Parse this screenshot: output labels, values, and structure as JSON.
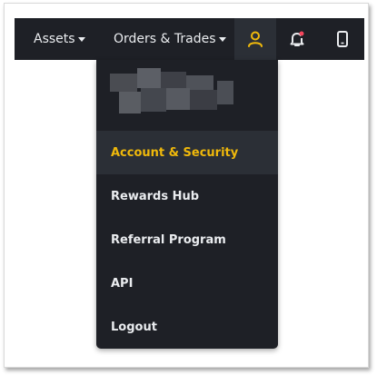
{
  "nav": {
    "assets_label": "Assets",
    "orders_label": "Orders & Trades"
  },
  "icons": {
    "user": "user-icon",
    "bell": "bell-icon",
    "phone": "mobile-icon"
  },
  "menu": {
    "items": [
      {
        "label": "Account & Security",
        "active": true
      },
      {
        "label": "Rewards Hub"
      },
      {
        "label": "Referral Program"
      },
      {
        "label": "API"
      },
      {
        "label": "Logout"
      }
    ]
  },
  "colors": {
    "background": "#1e2026",
    "hover": "#2b2f36",
    "accent": "#f0b90b",
    "text": "#eaecef",
    "notification_dot": "#f6465d"
  }
}
